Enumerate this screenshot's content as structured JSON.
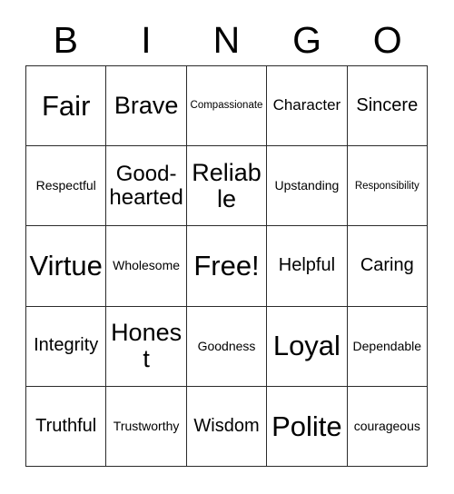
{
  "card": {
    "title": "Bingo Card",
    "header_letters": [
      "B",
      "I",
      "N",
      "G",
      "O"
    ],
    "columns": 5,
    "rows": 5,
    "border_color": "#2b2b2b",
    "background_color": "#ffffff",
    "text_color": "#000000",
    "free_space_label": "Free!",
    "free_space_position": {
      "row": 3,
      "column": 3
    },
    "cells": [
      [
        {
          "text": "Fair",
          "size": "fs-xxl"
        },
        {
          "text": "Brave",
          "size": "fs-xl"
        },
        {
          "text": "Compassionate",
          "size": "fs-xxs"
        },
        {
          "text": "Character",
          "size": "fs-sm"
        },
        {
          "text": "Sincere",
          "size": "fs-md"
        }
      ],
      [
        {
          "text": "Respectful",
          "size": "fs-xs"
        },
        {
          "text": "Good-hearted",
          "size": "fs-lg"
        },
        {
          "text": "Reliable",
          "size": "fs-xl"
        },
        {
          "text": "Upstanding",
          "size": "fs-xs"
        },
        {
          "text": "Responsibility",
          "size": "fs-xxs"
        }
      ],
      [
        {
          "text": "Virtue",
          "size": "fs-xxl"
        },
        {
          "text": "Wholesome",
          "size": "fs-xs"
        },
        {
          "text": "Free!",
          "size": "fs-xxl"
        },
        {
          "text": "Helpful",
          "size": "fs-md"
        },
        {
          "text": "Caring",
          "size": "fs-md"
        }
      ],
      [
        {
          "text": "Integrity",
          "size": "fs-md"
        },
        {
          "text": "Honest",
          "size": "fs-xl"
        },
        {
          "text": "Goodness",
          "size": "fs-xs"
        },
        {
          "text": "Loyal",
          "size": "fs-xxl"
        },
        {
          "text": "Dependable",
          "size": "fs-xs"
        }
      ],
      [
        {
          "text": "Truthful",
          "size": "fs-md"
        },
        {
          "text": "Trustworthy",
          "size": "fs-xs"
        },
        {
          "text": "Wisdom",
          "size": "fs-md"
        },
        {
          "text": "Polite",
          "size": "fs-xxl"
        },
        {
          "text": "courageous",
          "size": "fs-xs"
        }
      ]
    ]
  }
}
